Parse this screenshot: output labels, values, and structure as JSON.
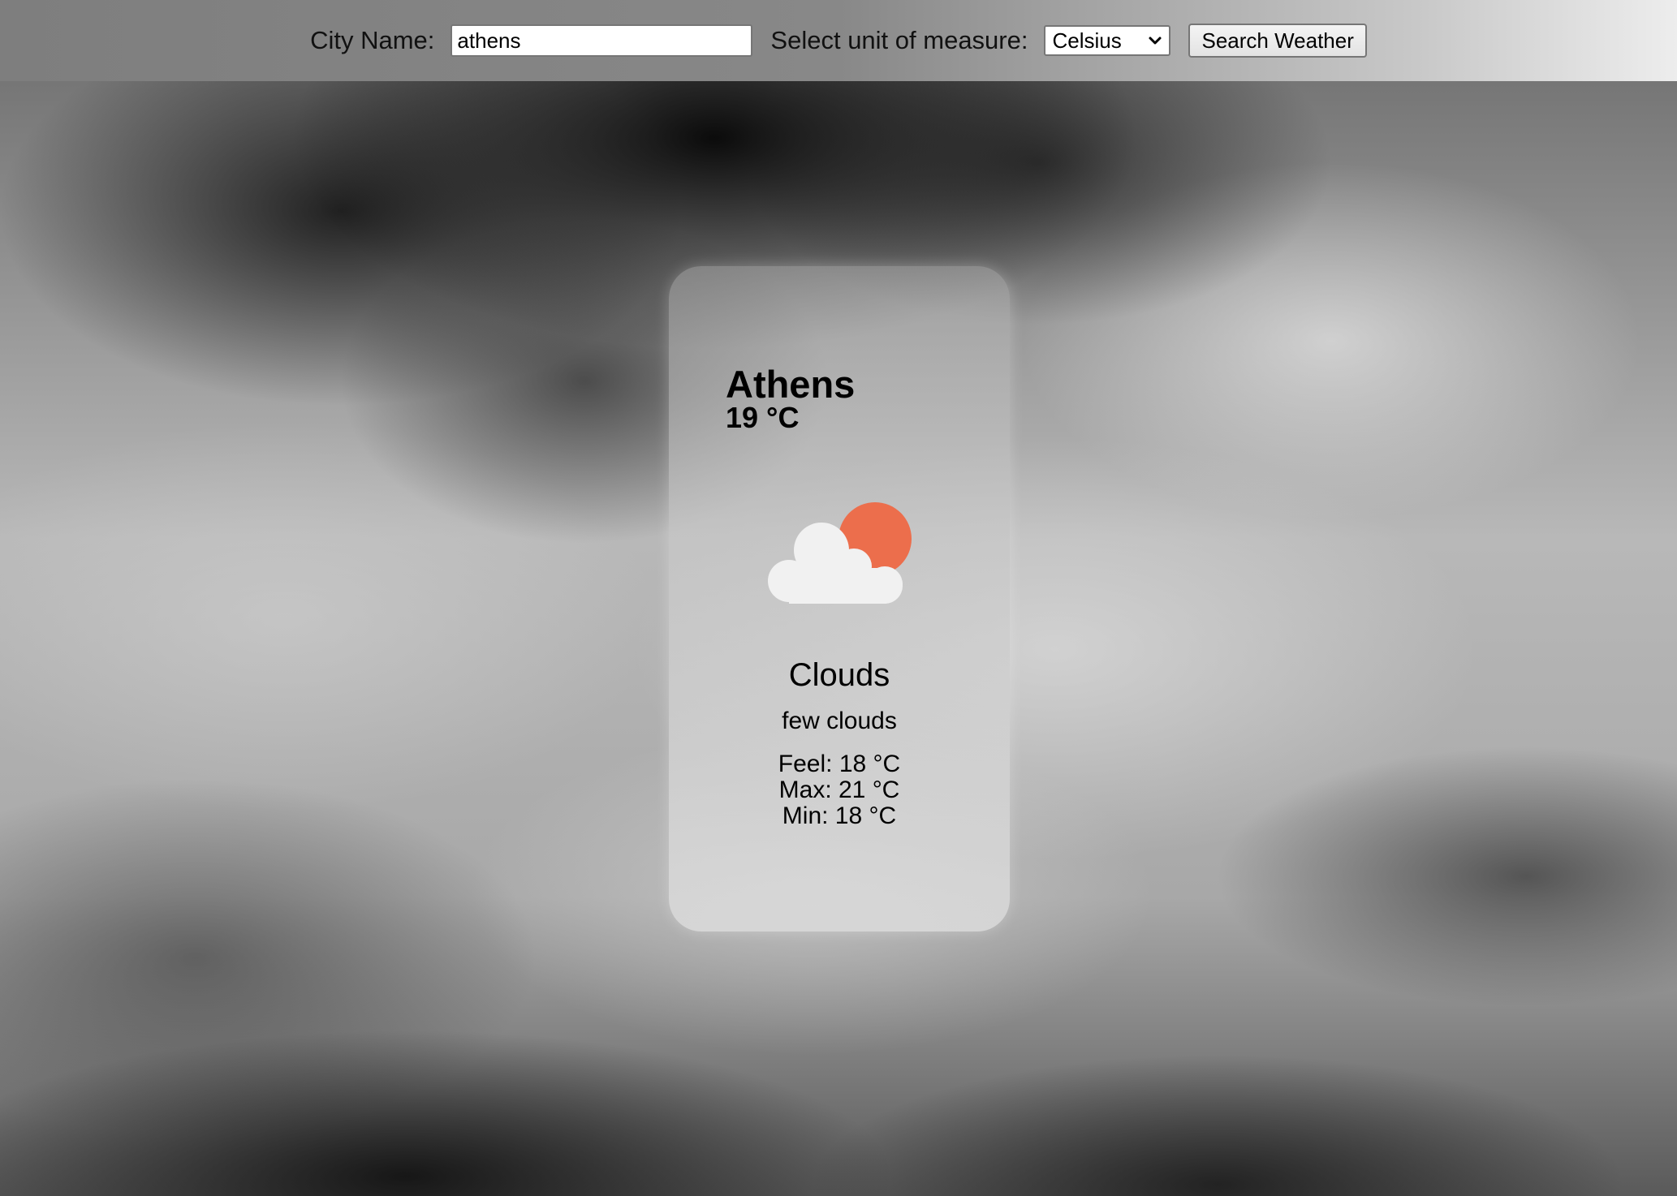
{
  "search": {
    "city_label": "City Name:",
    "city_value": "athens",
    "unit_label": "Select unit of measure:",
    "unit_selected": "Celsius",
    "button_label": "Search Weather"
  },
  "weather": {
    "city": "Athens",
    "temperature": "19 °C",
    "icon": "few-clouds-day-icon",
    "main": "Clouds",
    "description": "few clouds",
    "feel": "Feel: 18 °C",
    "max": "Max: 21 °C",
    "min": "Min: 18 °C"
  },
  "colors": {
    "sun": "#ec6e4c",
    "cloud": "#f1f1f1"
  }
}
